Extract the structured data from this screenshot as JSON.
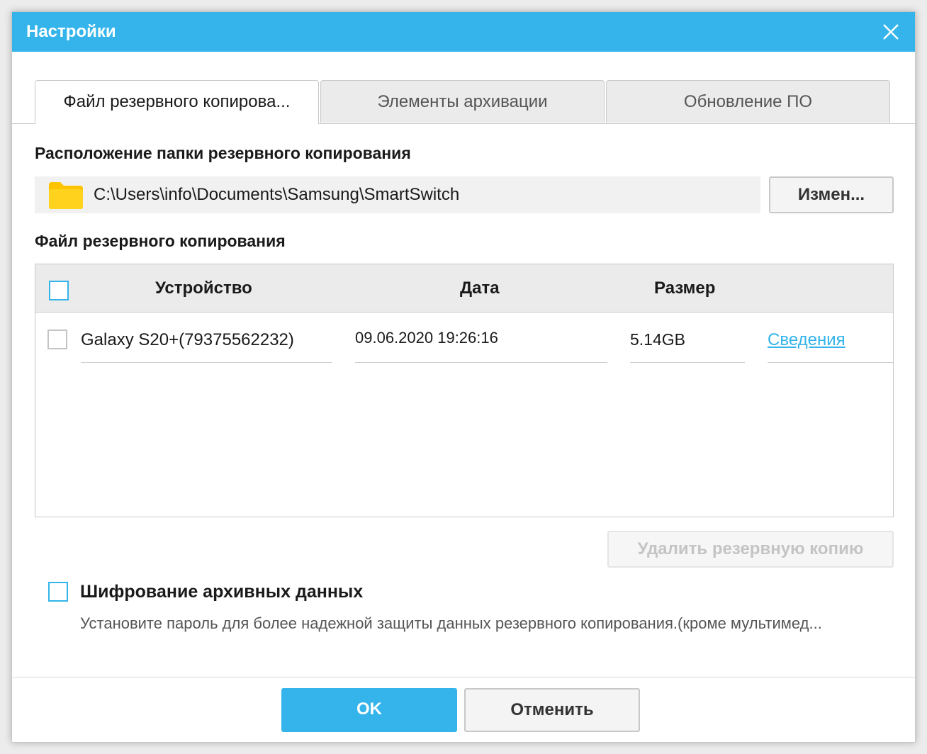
{
  "window": {
    "title": "Настройки"
  },
  "tabs": [
    {
      "label": "Файл резервного копирова...",
      "active": true
    },
    {
      "label": "Элементы архивации",
      "active": false
    },
    {
      "label": "Обновление ПО",
      "active": false
    }
  ],
  "location": {
    "heading": "Расположение папки резервного копирования",
    "path": "C:\\Users\\info\\Documents\\Samsung\\SmartSwitch",
    "change_label": "Измен..."
  },
  "backup_files": {
    "heading": "Файл резервного копирования",
    "columns": {
      "device": "Устройство",
      "date": "Дата",
      "size": "Размер"
    },
    "rows": [
      {
        "device": "Galaxy S20+(79375562232)",
        "date": "09.06.2020 19:26:16",
        "size": "5.14GB",
        "details": "Сведения"
      }
    ],
    "delete_label": "Удалить резервную копию"
  },
  "encryption": {
    "title": "Шифрование архивных данных",
    "description": "Установите пароль для более надежной защиты данных резервного копирования.(кроме мультимед..."
  },
  "footer": {
    "ok_label": "OK",
    "cancel_label": "Отменить"
  },
  "colors": {
    "accent": "#34b4ea",
    "folder": "#ffc400"
  },
  "icons": {
    "close": "close-icon",
    "folder": "folder-icon"
  }
}
